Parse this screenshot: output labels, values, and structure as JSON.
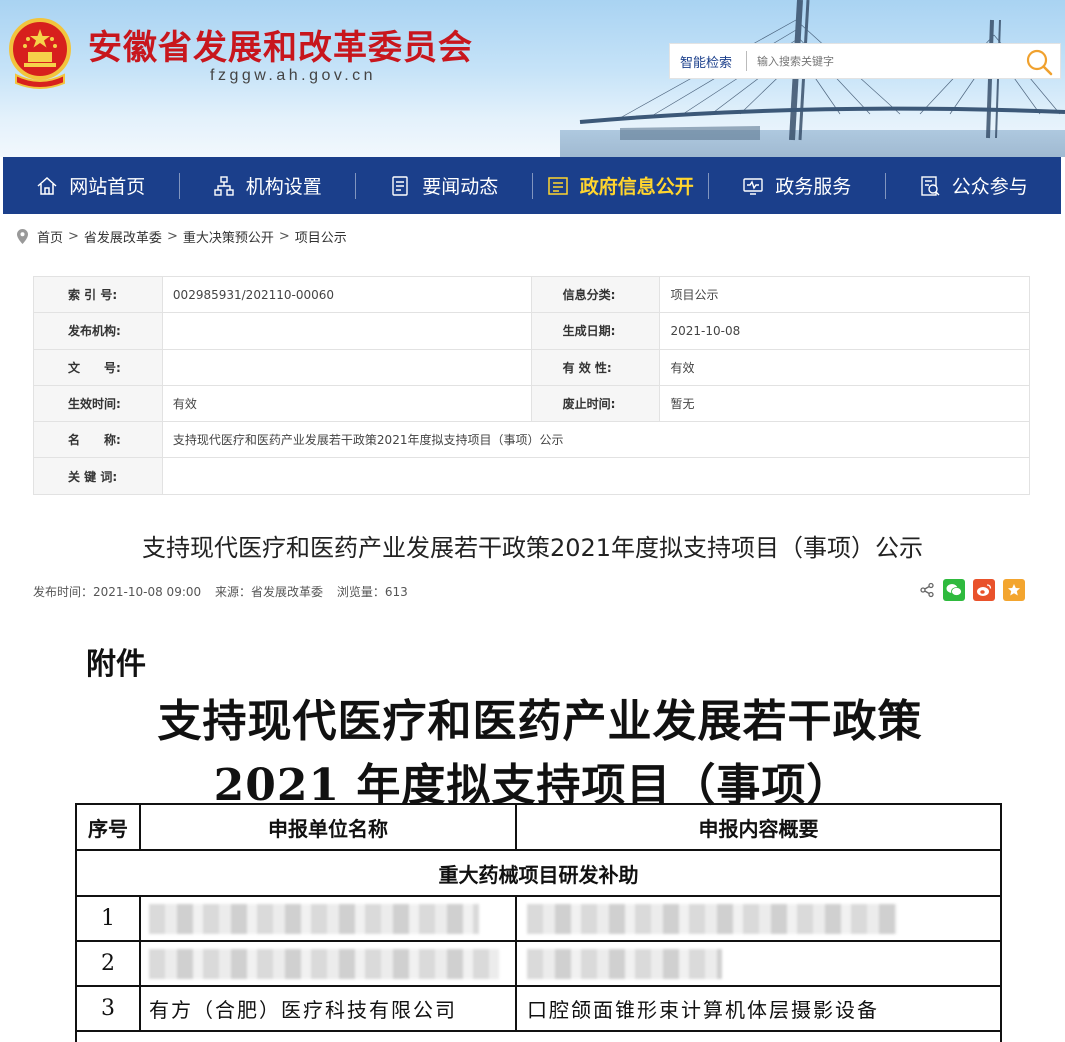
{
  "header": {
    "title": "安徽省发展和改革委员会",
    "domain": "fzggw.ah.gov.cn",
    "search": {
      "label": "智能检索",
      "placeholder": "输入搜索关键字"
    }
  },
  "nav": [
    {
      "label": "网站首页",
      "icon": "home-icon"
    },
    {
      "label": "机构设置",
      "icon": "org-chart-icon"
    },
    {
      "label": "要闻动态",
      "icon": "news-icon"
    },
    {
      "label": "政府信息公开",
      "icon": "document-icon",
      "active": true
    },
    {
      "label": "政务服务",
      "icon": "monitor-icon"
    },
    {
      "label": "公众参与",
      "icon": "participation-icon"
    }
  ],
  "breadcrumb": [
    "首页",
    "省发展改革委",
    "重大决策预公开",
    "项目公示"
  ],
  "meta": {
    "index_no_label": "索 引 号:",
    "index_no": "002985931/202110-00060",
    "category_label": "信息分类:",
    "category": "项目公示",
    "publisher_label": "发布机构:",
    "publisher": "",
    "gen_date_label": "生成日期:",
    "gen_date": "2021-10-08",
    "doc_no_label": "文　　号:",
    "doc_no": "",
    "validity_label": "有 效 性:",
    "validity": "有效",
    "effective_label": "生效时间:",
    "effective": "有效",
    "expire_label": "废止时间:",
    "expire": "暂无",
    "name_label": "名　　称:",
    "name": "支持现代医疗和医药产业发展若干政策2021年度拟支持项目（事项）公示",
    "keywords_label": "关 键 词:",
    "keywords": ""
  },
  "article": {
    "title": "支持现代医疗和医药产业发展若干政策2021年度拟支持项目（事项）公示",
    "publish_time": "发布时间：2021-10-08 09:00",
    "source": "来源：省发展改革委",
    "views": "浏览量：613"
  },
  "attachment": {
    "label": "附件",
    "title_line1": "支持现代医疗和医药产业发展若干政策",
    "title_line2": "2021 年度拟支持项目（事项）",
    "headers": [
      "序号",
      "申报单位名称",
      "申报内容概要"
    ],
    "section": "重大药械项目研发补助",
    "rows": [
      {
        "no": "1",
        "unit": "",
        "desc": "",
        "blurred": true
      },
      {
        "no": "2",
        "unit": "",
        "desc": "",
        "blurred": true
      },
      {
        "no": "3",
        "unit": "有方（合肥）医疗科技有限公司",
        "desc": "口腔颌面锥形束计算机体层摄影设备",
        "blurred": false
      }
    ]
  },
  "colors": {
    "nav_bg": "#1b3f8b",
    "title_red": "#c8161d",
    "nav_active": "#ffd52e"
  }
}
